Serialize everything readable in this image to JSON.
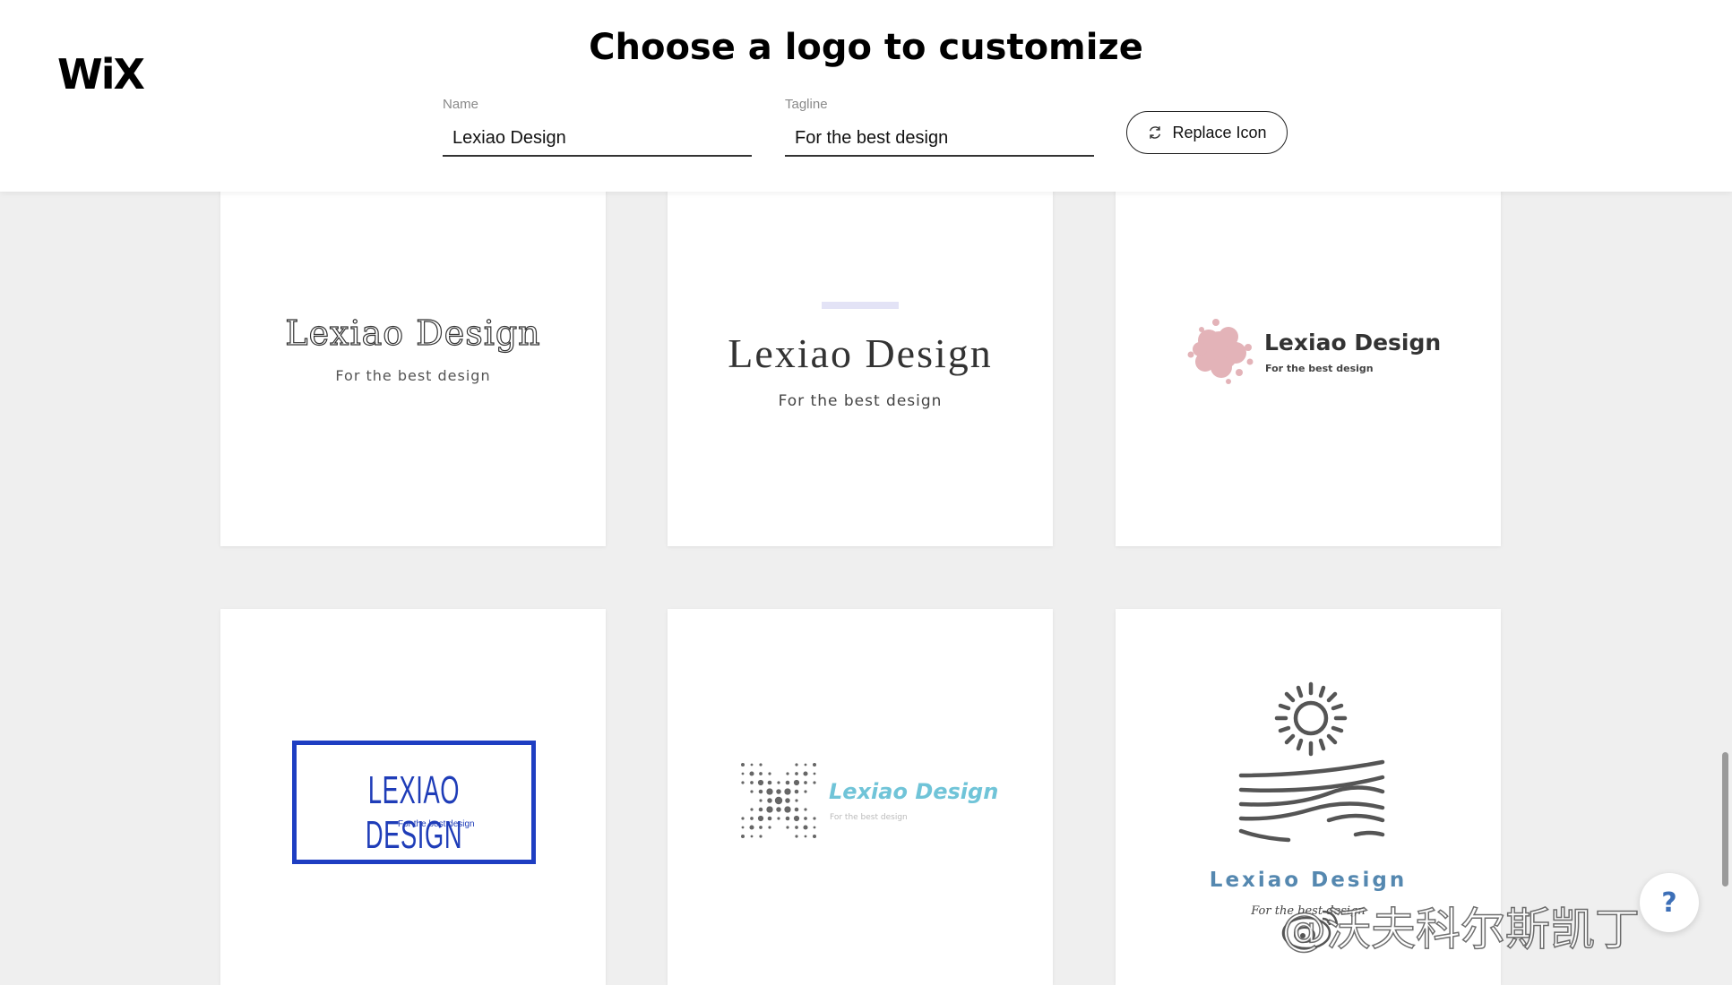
{
  "header": {
    "logo_text": "WiX",
    "title": "Choose a logo to customize",
    "name_label": "Name",
    "name_value": "Lexiao Design",
    "tagline_label": "Tagline",
    "tagline_value": "For the best design",
    "replace_icon_label": "Replace Icon"
  },
  "cards": [
    {
      "name": "Lexiao Design",
      "tagline": "For the best design"
    },
    {
      "name": "Lexiao Design",
      "tagline": "For the best design"
    },
    {
      "name": "Lexiao Design",
      "tagline": "For the best design"
    },
    {
      "name": "LEXIAO DESIGN",
      "tagline": "For the best design"
    },
    {
      "name": "Lexiao Design",
      "tagline": "For the best design"
    },
    {
      "name": "Lexiao Design",
      "tagline": "For the best design"
    }
  ],
  "help": {
    "label": "?"
  },
  "watermark": {
    "text": "@沃夫科尔斯凯丁"
  },
  "colors": {
    "blue_frame": "#1e3ec2",
    "teal_text": "#70c4d8",
    "pink_blob": "#e3b3b8",
    "steel_blue_text": "#5588b0"
  }
}
